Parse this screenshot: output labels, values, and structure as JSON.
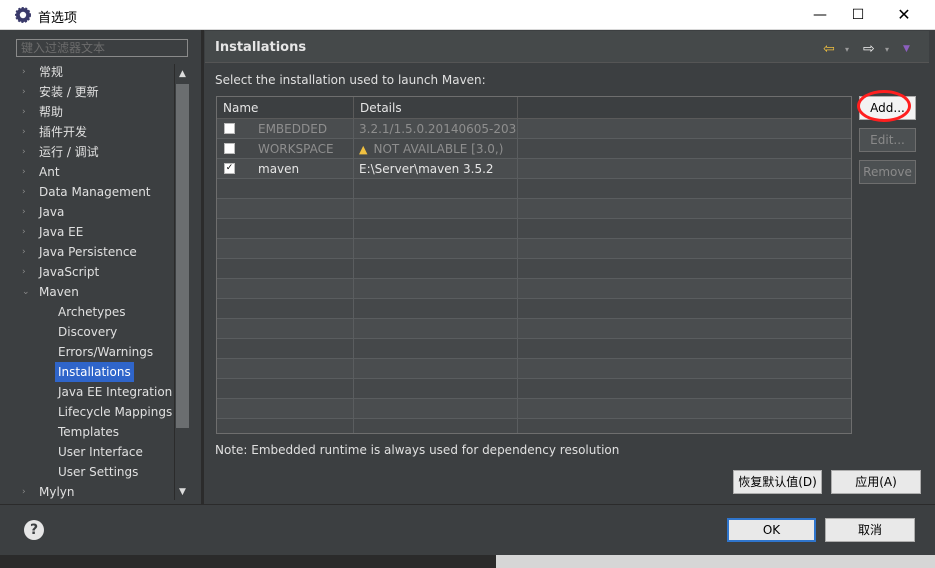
{
  "window": {
    "title": "首选项",
    "min": "—",
    "max": "☐",
    "close": "✕"
  },
  "filter": {
    "placeholder": "键入过滤器文本"
  },
  "tree": {
    "items": [
      {
        "label": "常规",
        "arrow": "›",
        "child": false
      },
      {
        "label": "安装 / 更新",
        "arrow": "›",
        "child": false
      },
      {
        "label": "帮助",
        "arrow": "›",
        "child": false
      },
      {
        "label": "插件开发",
        "arrow": "›",
        "child": false
      },
      {
        "label": "运行 / 调试",
        "arrow": "›",
        "child": false
      },
      {
        "label": "Ant",
        "arrow": "›",
        "child": false
      },
      {
        "label": "Data Management",
        "arrow": "›",
        "child": false
      },
      {
        "label": "Java",
        "arrow": "›",
        "child": false
      },
      {
        "label": "Java EE",
        "arrow": "›",
        "child": false
      },
      {
        "label": "Java Persistence",
        "arrow": "›",
        "child": false
      },
      {
        "label": "JavaScript",
        "arrow": "›",
        "child": false
      },
      {
        "label": "Maven",
        "arrow": "⌄",
        "child": false
      },
      {
        "label": "Archetypes",
        "arrow": "",
        "child": true
      },
      {
        "label": "Discovery",
        "arrow": "",
        "child": true
      },
      {
        "label": "Errors/Warnings",
        "arrow": "",
        "child": true
      },
      {
        "label": "Installations",
        "arrow": "",
        "child": true,
        "selected": true
      },
      {
        "label": "Java EE Integration",
        "arrow": "",
        "child": true
      },
      {
        "label": "Lifecycle Mappings",
        "arrow": "",
        "child": true
      },
      {
        "label": "Templates",
        "arrow": "",
        "child": true
      },
      {
        "label": "User Interface",
        "arrow": "",
        "child": true
      },
      {
        "label": "User Settings",
        "arrow": "",
        "child": true
      },
      {
        "label": "Mylyn",
        "arrow": "›",
        "child": false
      }
    ]
  },
  "page": {
    "title": "Installations",
    "instruction": "Select the installation used to launch Maven:",
    "note": "Note: Embedded runtime is always used for dependency resolution"
  },
  "table": {
    "headers": {
      "name": "Name",
      "details": "Details"
    },
    "rows": [
      {
        "checked": false,
        "name": "EMBEDDED",
        "details": "3.2.1/1.5.0.20140605-2032",
        "warn": false,
        "dim": true
      },
      {
        "checked": false,
        "name": "WORKSPACE",
        "details": "NOT AVAILABLE [3.0,)",
        "warn": true,
        "dim": true
      },
      {
        "checked": true,
        "name": "maven",
        "details": "E:\\Server\\maven 3.5.2",
        "warn": false,
        "dim": false
      }
    ],
    "empty_rows": 13,
    "check_glyph": "✓",
    "warn_glyph": "▲"
  },
  "buttons": {
    "add": "Add...",
    "edit": "Edit...",
    "remove": "Remove",
    "restore": "恢复默认值(D)",
    "apply": "应用(A)",
    "ok": "OK",
    "cancel": "取消",
    "help": "?"
  },
  "nav": {
    "back": "⇦",
    "forward": "⇨",
    "dropdown": "▾",
    "menu": "▼"
  }
}
